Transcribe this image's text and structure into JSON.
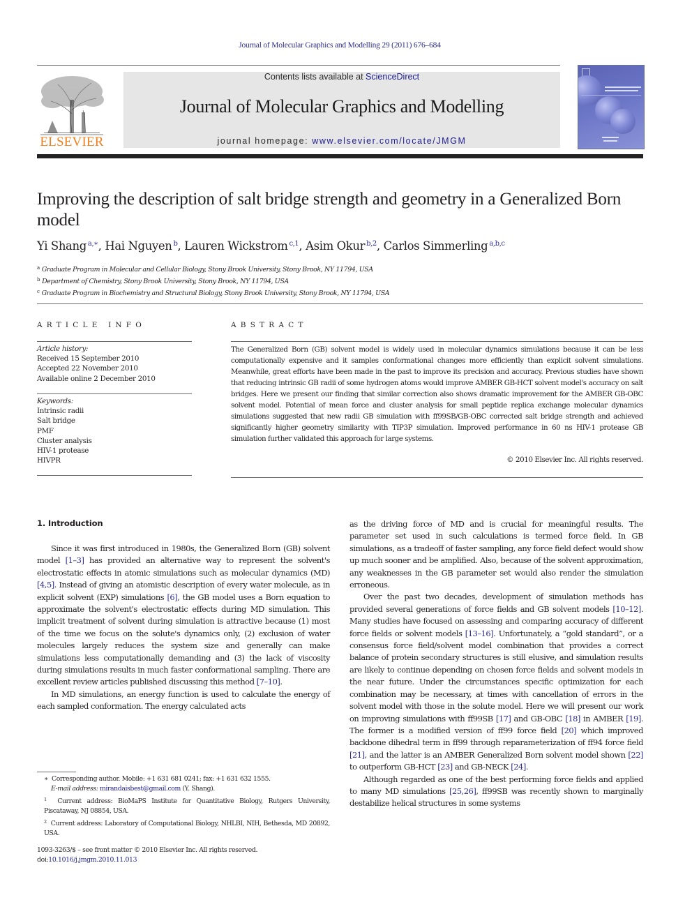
{
  "running_header": "Journal of Molecular Graphics and Modelling 29 (2011) 676–684",
  "masthead": {
    "publisher_logo_text": "ELSEVIER",
    "contents_prefix": "Contents lists available at ",
    "contents_link": "ScienceDirect",
    "journal_name": "Journal of Molecular Graphics and Modelling",
    "homepage_prefix": "journal homepage: ",
    "homepage_link": "www.elsevier.com/locate/JMGM",
    "cover_alt": "Journal cover: Journal of Molecular Graphics & Modelling"
  },
  "article": {
    "title": "Improving the description of salt bridge strength and geometry in a Generalized Born model",
    "authors": [
      {
        "name": "Yi Shang",
        "marks": "a,∗"
      },
      {
        "name": "Hai Nguyen",
        "marks": "b"
      },
      {
        "name": "Lauren Wickstrom",
        "marks": "c,1"
      },
      {
        "name": "Asim Okur",
        "marks": "b,2"
      },
      {
        "name": "Carlos Simmerling",
        "marks": "a,b,c"
      }
    ],
    "affiliations": [
      {
        "mark": "a",
        "text": "Graduate Program in Molecular and Cellular Biology, Stony Brook University, Stony Brook, NY 11794, USA"
      },
      {
        "mark": "b",
        "text": "Department of Chemistry, Stony Brook University, Stony Brook, NY 11794, USA"
      },
      {
        "mark": "c",
        "text": "Graduate Program in Biochemistry and Structural Biology, Stony Brook University, Stony Brook, NY 11794, USA"
      }
    ]
  },
  "article_info": {
    "heading": "ARTICLE INFO",
    "history_label": "Article history:",
    "history": [
      "Received 15 September 2010",
      "Accepted 22 November 2010",
      "Available online 2 December 2010"
    ],
    "keywords_label": "Keywords:",
    "keywords": [
      "Intrinsic radii",
      "Salt bridge",
      "PMF",
      "Cluster analysis",
      "HIV-1 protease",
      "HIVPR"
    ]
  },
  "abstract": {
    "heading": "ABSTRACT",
    "text": "The Generalized Born (GB) solvent model is widely used in molecular dynamics simulations because it can be less computationally expensive and it samples conformational changes more efficiently than explicit solvent simulations. Meanwhile, great efforts have been made in the past to improve its precision and accuracy. Previous studies have shown that reducing intrinsic GB radii of some hydrogen atoms would improve AMBER GB-HCT solvent model's accuracy on salt bridges. Here we present our finding that similar correction also shows dramatic improvement for the AMBER GB-OBC solvent model. Potential of mean force and cluster analysis for small peptide replica exchange molecular dynamics simulations suggested that new radii GB simulation with ff99SB/GB-OBC corrected salt bridge strength and achieved significantly higher geometry similarity with TIP3P simulation. Improved performance in 60 ns HIV-1 protease GB simulation further validated this approach for large systems.",
    "copyright": "© 2010 Elsevier Inc. All rights reserved."
  },
  "body": {
    "section_heading": "1.  Introduction",
    "left_paragraphs": [
      [
        {
          "t": "Since it was first introduced in 1980s, the Generalized Born (GB) solvent model "
        },
        {
          "c": "[1–3]"
        },
        {
          "t": " has provided an alternative way to represent the solvent's electrostatic effects in atomic simulations such as molecular dynamics (MD) "
        },
        {
          "c": "[4,5]"
        },
        {
          "t": ". Instead of giving an atomistic description of every water molecule, as in explicit solvent (EXP) simulations "
        },
        {
          "c": "[6]"
        },
        {
          "t": ", the GB model uses a Born equation to approximate the solvent's electrostatic effects during MD simulation. This implicit treatment of solvent during simulation is attractive because (1) most of the time we focus on the solute's dynamics only, (2) exclusion of water molecules largely reduces the system size and generally can make simulations less computationally demanding and (3) the lack of viscosity during simulations results in much faster conformational sampling. There are excellent review articles published discussing this method "
        },
        {
          "c": "[7–10]"
        },
        {
          "t": "."
        }
      ],
      [
        {
          "t": "In MD simulations, an energy function is used to calculate the energy of each sampled conformation. The energy calculated acts"
        }
      ]
    ],
    "right_paragraphs": [
      [
        {
          "t": "as the driving force of MD and is crucial for meaningful results. The parameter set used in such calculations is termed force field. In GB simulations, as a tradeoff of faster sampling, any force field defect would show up much sooner and be amplified. Also, because of the solvent approximation, any weaknesses in the GB parameter set would also render the simulation erroneous."
        }
      ],
      [
        {
          "t": "Over the past two decades, development of simulation methods has provided several generations of force fields and GB solvent models "
        },
        {
          "c": "[10–12]"
        },
        {
          "t": ". Many studies have focused on assessing and comparing accuracy of different force fields or solvent models "
        },
        {
          "c": "[13–16]"
        },
        {
          "t": ". Unfortunately, a “gold standard”, or a consensus force field/solvent model combination that provides a correct balance of protein secondary structures is still elusive, and simulation results are likely to continue depending on chosen force fields and solvent models in the near future. Under the circumstances specific optimization for each combination may be necessary, at times with cancellation of errors in the solvent model with those in the solute model. Here we will present our work on improving simulations with ff99SB "
        },
        {
          "c": "[17]"
        },
        {
          "t": " and GB-OBC "
        },
        {
          "c": "[18]"
        },
        {
          "t": " in AMBER "
        },
        {
          "c": "[19]"
        },
        {
          "t": ". The former is a modified version of ff99 force field "
        },
        {
          "c": "[20]"
        },
        {
          "t": " which improved backbone dihedral term in ff99 through reparameterization of ff94 force field "
        },
        {
          "c": "[21]"
        },
        {
          "t": ", and the latter is an AMBER Generalized Born solvent model shown "
        },
        {
          "c": "[22]"
        },
        {
          "t": " to outperform GB-HCT "
        },
        {
          "c": "[23]"
        },
        {
          "t": " and GB-NECK "
        },
        {
          "c": "[24]"
        },
        {
          "t": "."
        }
      ],
      [
        {
          "t": "Although regarded as one of the best performing force fields and applied to many MD simulations "
        },
        {
          "c": "[25,26]"
        },
        {
          "t": ", ff99SB was recently shown to marginally destabilize helical structures in some systems"
        }
      ]
    ]
  },
  "footnotes": {
    "corresponding_mark": "∗",
    "corresponding_text": "Corresponding author. Mobile: +1 631 681 0241; fax: +1 631 632 1555.",
    "email_label": "E-mail address:",
    "email": "mirandaisbest@gmail.com",
    "email_suffix": " (Y. Shang).",
    "note1_mark": "1",
    "note1_text": "Current address: BioMaPS Institute for Quantitative Biology, Rutgers University, Piscataway, NJ 08854, USA.",
    "note2_mark": "2",
    "note2_text": "Current address: Laboratory of Computational Biology, NHLBI, NIH, Bethesda, MD 20892, USA."
  },
  "front_matter": {
    "issn_line": "1093-3263/$ – see front matter © 2010 Elsevier Inc. All rights reserved.",
    "doi_prefix": "doi:",
    "doi": "10.1016/j.jmgm.2010.11.013"
  },
  "colors": {
    "link": "#1d1d8f",
    "elsevier_orange": "#f07f1c",
    "masthead_gray": "#e6e6e7"
  }
}
